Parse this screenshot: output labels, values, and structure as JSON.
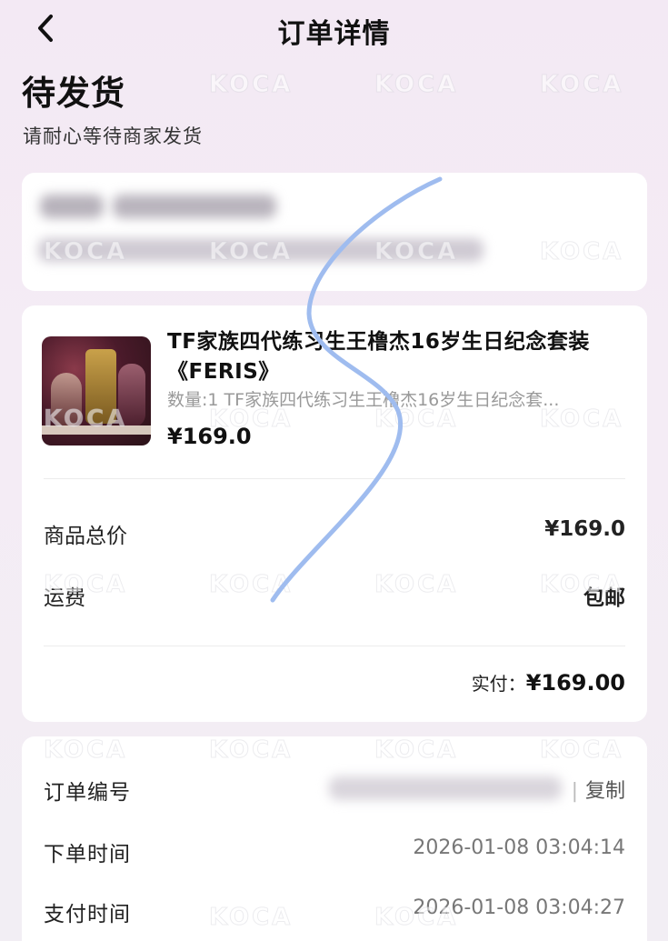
{
  "header": {
    "title": "订单详情"
  },
  "status": {
    "title": "待发货",
    "subtitle": "请耐心等待商家发货"
  },
  "product": {
    "name": "TF家族四代练习生王橹杰16岁生日纪念套装《FERIS》",
    "spec": "数量:1 TF家族四代练习生王橹杰16岁生日纪念套...",
    "price": "¥169.0"
  },
  "summary": {
    "goods_total_label": "商品总价",
    "goods_total_value": "¥169.0",
    "shipping_label": "运费",
    "shipping_value": "包邮",
    "actual_label": "实付：",
    "actual_value": "¥169.00"
  },
  "info": {
    "order_no_label": "订单编号",
    "copy_label": "复制",
    "copy_separator": "|",
    "order_time_label": "下单时间",
    "order_time_value": "2026-01-08 03:04:14",
    "pay_time_label": "支付时间",
    "pay_time_value": "2026-01-08 03:04:27"
  },
  "watermark": {
    "text": "KOCA"
  },
  "colors": {
    "scribble": "#9fbcef",
    "background": "#f3e9f4"
  }
}
